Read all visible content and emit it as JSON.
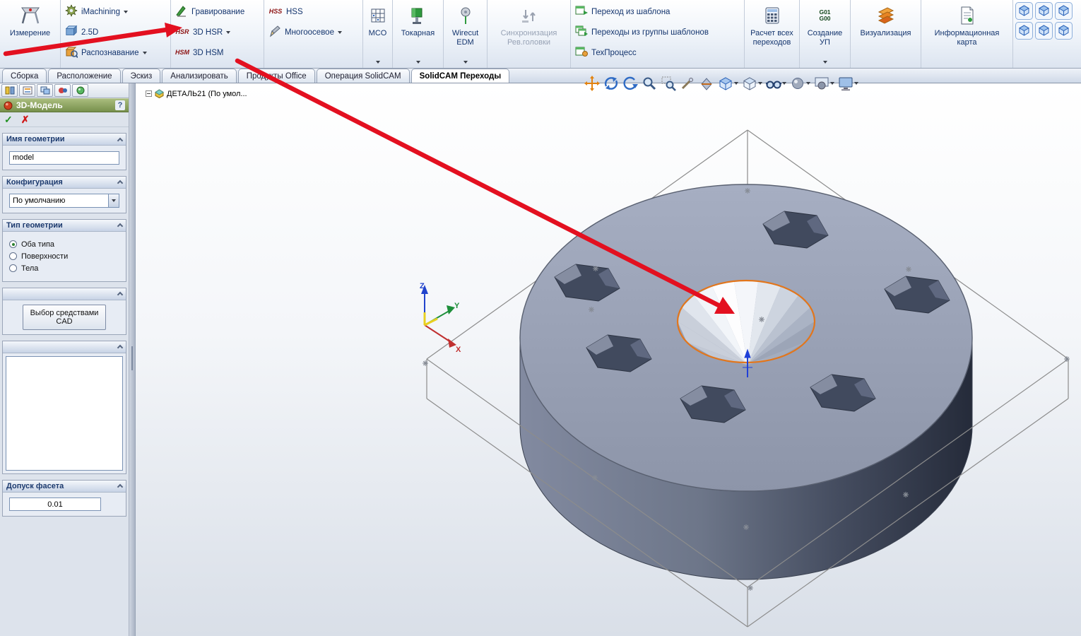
{
  "ribbon": {
    "measure": "Измерение",
    "imachining": "iMachining",
    "d25": "2.5D",
    "recognize": "Распознавание",
    "engrave": "Гравирование",
    "hsr3d": "3D HSR",
    "hsm3d": "3D HSM",
    "hss": "HSS",
    "multiaxis": "Многоосевое",
    "mco": "MCO",
    "turning": "Токарная",
    "wirecut": "Wirecut EDM",
    "sync": "Синхронизация Рев.головки",
    "tpl_single": "Переход из шаблона",
    "tpl_group": "Переходы из группы шаблонов",
    "techproc": "ТехПроцесс",
    "calc": "Расчет всех переходов",
    "nc": "Создание УП",
    "visual": "Визуализация",
    "infocard": "Информационная карта",
    "icon_hss": "HSS",
    "icon_hsr": "HSR",
    "icon_hsm": "HSM",
    "icon_g01": "G01",
    "icon_g00": "G00"
  },
  "tabs": [
    {
      "label": "Сборка"
    },
    {
      "label": "Расположение"
    },
    {
      "label": "Эскиз"
    },
    {
      "label": "Анализировать"
    },
    {
      "label": "Продукты Office"
    },
    {
      "label": "Операция SolidCAM"
    },
    {
      "label": "SolidCAM Переходы"
    }
  ],
  "tree": {
    "root": "ДЕТАЛЬ21  (По умол..."
  },
  "panel": {
    "title": "3D-Модель",
    "help": "?",
    "ok": "✓",
    "cancel": "✗",
    "geometry_name_header": "Имя геометрии",
    "geometry_name_value": "model",
    "config_header": "Конфигурация",
    "config_value": "По умолчанию",
    "type_header": "Тип геометрии",
    "radio_both": "Оба типа",
    "radio_surfaces": "Поверхности",
    "radio_bodies": "Тела",
    "cad_button": "Выбор средствами CAD",
    "facet_header": "Допуск фасета",
    "facet_value": "0.01"
  },
  "viewport": {
    "triad": {
      "x": "X",
      "y": "Y",
      "z": "Z"
    }
  },
  "colors": {
    "annotation_arrow": "#e31020",
    "cone_highlight": "#e2761c",
    "model_body": "#99a1b5"
  }
}
